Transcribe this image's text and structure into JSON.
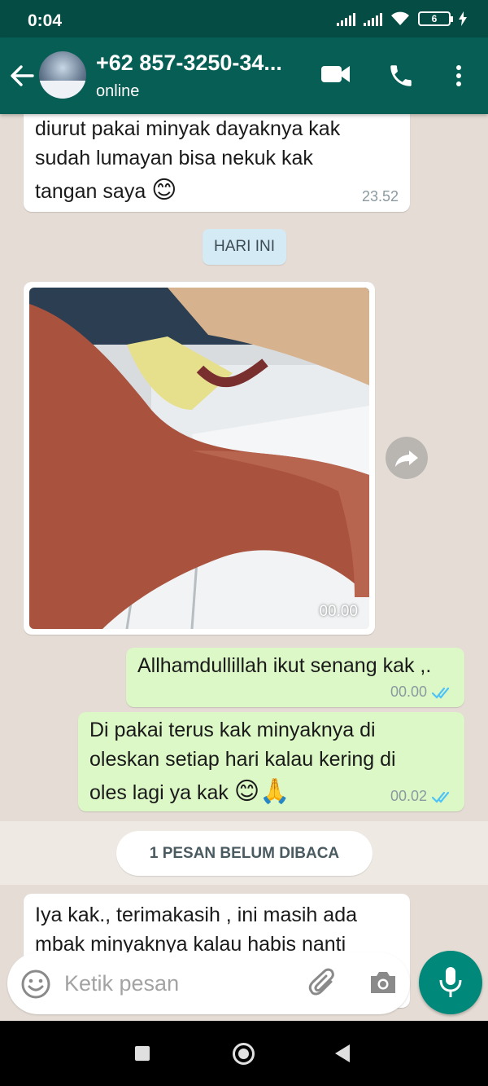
{
  "status_bar": {
    "time": "0:04",
    "battery": "6"
  },
  "header": {
    "contact_name": "+62 857-3250-34...",
    "status": "online"
  },
  "messages": [
    {
      "direction": "in",
      "lines": [
        "diurut pakai minyak dayaknya kak",
        "sudah lumayan bisa nekuk kak",
        "tangan saya"
      ],
      "emoji": "😊",
      "time": "23.52"
    },
    {
      "direction": "in",
      "type": "photo",
      "time": "00.00"
    },
    {
      "direction": "out",
      "text": "Allhamdullillah ikut senang kak ,.",
      "time": "00.00",
      "read": true
    },
    {
      "direction": "out",
      "lines": [
        "Di pakai terus kak minyaknya di",
        "oleskan setiap hari kalau kering di",
        "oles lagi ya kak"
      ],
      "emoji": "😊🙏",
      "time": "00.02",
      "read": true
    },
    {
      "direction": "in",
      "lines": [
        "Iya kak., terimakasih ,  ini masih ada",
        "mbak minyaknya kalau habis nanti"
      ]
    }
  ],
  "date_chip": "HARI INI",
  "unread_banner": "1 PESAN BELUM DIBACA",
  "input": {
    "placeholder": "Ketik pesan"
  },
  "icons": {
    "back": "arrow-left-icon",
    "video": "video-call-icon",
    "call": "phone-icon",
    "more": "more-vertical-icon",
    "emoji": "emoji-icon",
    "attach": "paperclip-icon",
    "camera": "camera-icon",
    "mic": "mic-icon",
    "forward": "forward-icon"
  },
  "colors": {
    "header": "#075e54",
    "status_bar": "#054d44",
    "outgoing_bubble": "#dcf8c6",
    "incoming_bubble": "#ffffff",
    "chat_bg": "#e5ddd5",
    "read_ticks": "#4fc3f7",
    "mic_button": "#00897b"
  }
}
